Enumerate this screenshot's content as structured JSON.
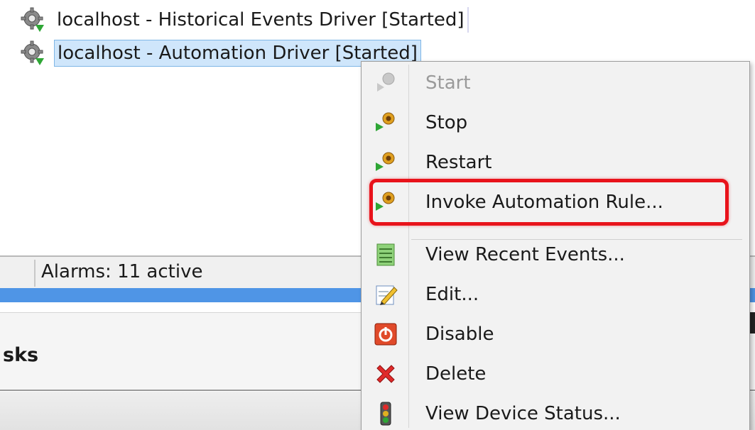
{
  "tree": {
    "items": [
      {
        "label": "localhost - Historical Events Driver [Started]",
        "icon": "gear-started-icon"
      },
      {
        "label": "localhost - Automation Driver [Started]",
        "icon": "gear-started-icon",
        "selected": true
      }
    ]
  },
  "status_bar": {
    "alarms": "Alarms: 11 active"
  },
  "tasks_panel": {
    "title": "sks"
  },
  "context_menu": {
    "items": [
      {
        "label": "Start",
        "icon": "play-gear-icon",
        "enabled": false
      },
      {
        "label": "Stop",
        "icon": "play-gear-icon",
        "enabled": true
      },
      {
        "label": "Restart",
        "icon": "play-gear-icon",
        "enabled": true
      },
      {
        "label": "Invoke Automation Rule...",
        "icon": "play-gear-icon",
        "enabled": true,
        "highlighted": true
      },
      {
        "label": "View Recent Events...",
        "icon": "list-icon",
        "enabled": true
      },
      {
        "label": "Edit...",
        "icon": "edit-pencil-icon",
        "enabled": true
      },
      {
        "label": "Disable",
        "icon": "power-icon",
        "enabled": true
      },
      {
        "label": "Delete",
        "icon": "delete-x-icon",
        "enabled": true
      },
      {
        "label": "View Device Status...",
        "icon": "traffic-light-icon",
        "enabled": true
      }
    ]
  },
  "colors": {
    "selection": "#cfe6fb",
    "highlight_outline": "#e8131b",
    "blue_band": "#4f95e6",
    "menu_background": "#f2f2f2"
  }
}
